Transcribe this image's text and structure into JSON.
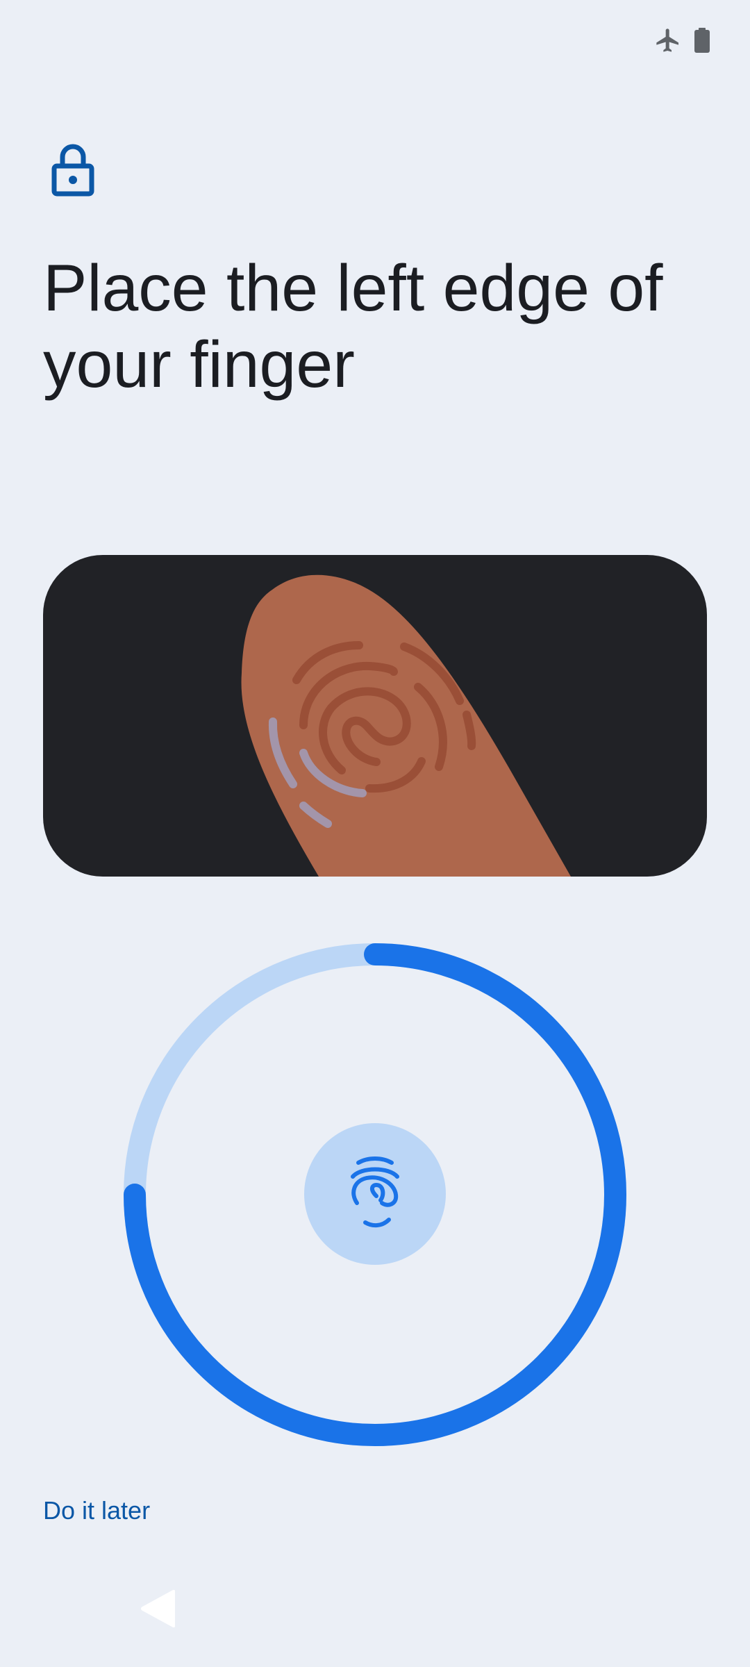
{
  "status_bar": {
    "icons": [
      "airplane-mode-icon",
      "battery-icon"
    ]
  },
  "header": {
    "icon": "lock-icon",
    "title": "Place the left edge of your finger"
  },
  "illustration": {
    "description_icon": "fingertip-illustration"
  },
  "enrollment": {
    "progress_fraction": 0.75,
    "center_icon": "fingerprint-icon"
  },
  "actions": {
    "do_it_later_label": "Do it later"
  },
  "navigation": {
    "back_icon": "back-triangle-icon"
  },
  "colors": {
    "background": "#EBEFF6",
    "accent": "#1A73E8",
    "accent_light": "#BBD6F6",
    "link": "#0B57A6",
    "illustration_bg": "#212226",
    "finger": "#AE674C"
  }
}
